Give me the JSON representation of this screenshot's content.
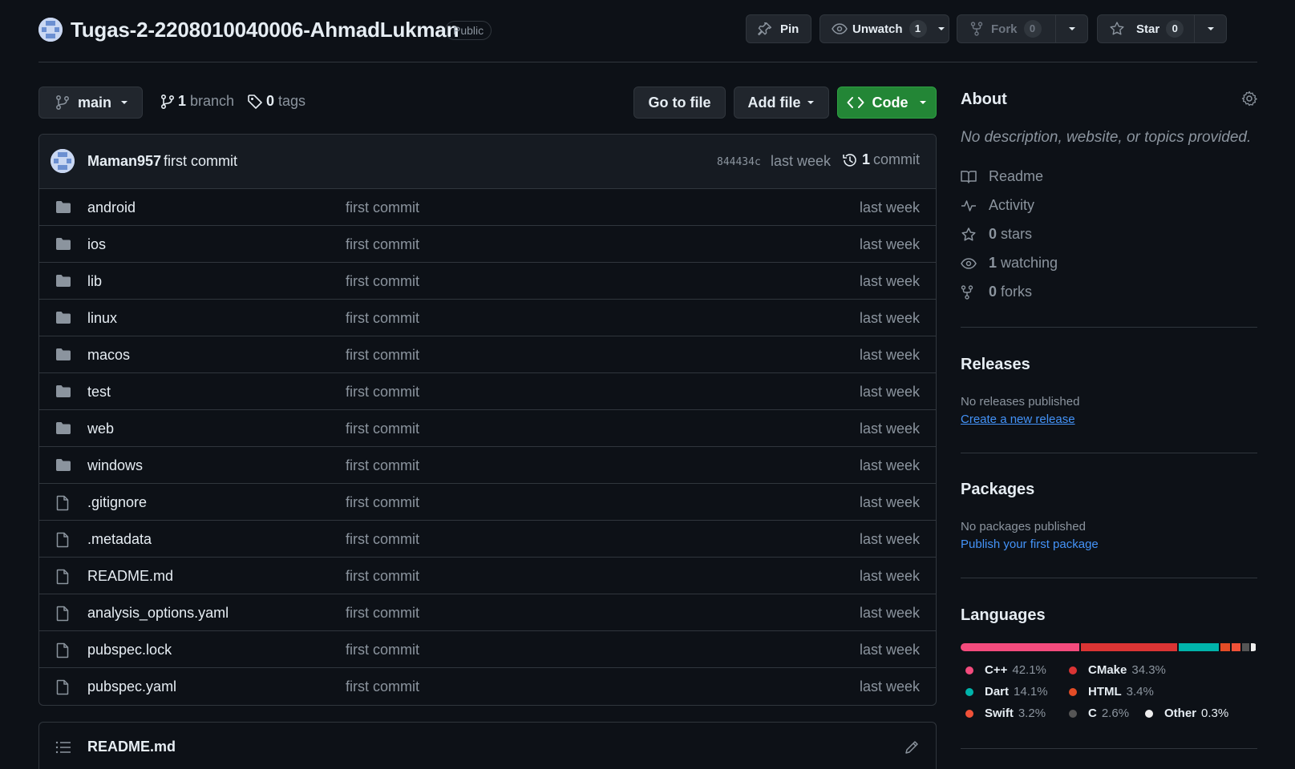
{
  "repo": {
    "name": "Tugas-2-2208010040006-AhmadLukman",
    "visibility": "Public"
  },
  "actions": {
    "pin_label": "Pin",
    "watch_label": "Unwatch",
    "watch_count": "1",
    "fork_label": "Fork",
    "fork_count": "0",
    "star_label": "Star",
    "star_count": "0"
  },
  "toolbar": {
    "branch": "main",
    "branches_count": "1",
    "branches_label": "branch",
    "tags_count": "0",
    "tags_label": "tags",
    "go_to_file": "Go to file",
    "add_file": "Add file",
    "code": "Code"
  },
  "latest_commit": {
    "author": "Maman957",
    "message": "first commit",
    "sha": "844434c",
    "when": "last week",
    "count": "1",
    "count_label": "commit"
  },
  "files": [
    {
      "name": "android",
      "type": "dir",
      "message": "first commit",
      "when": "last week"
    },
    {
      "name": "ios",
      "type": "dir",
      "message": "first commit",
      "when": "last week"
    },
    {
      "name": "lib",
      "type": "dir",
      "message": "first commit",
      "when": "last week"
    },
    {
      "name": "linux",
      "type": "dir",
      "message": "first commit",
      "when": "last week"
    },
    {
      "name": "macos",
      "type": "dir",
      "message": "first commit",
      "when": "last week"
    },
    {
      "name": "test",
      "type": "dir",
      "message": "first commit",
      "when": "last week"
    },
    {
      "name": "web",
      "type": "dir",
      "message": "first commit",
      "when": "last week"
    },
    {
      "name": "windows",
      "type": "dir",
      "message": "first commit",
      "when": "last week"
    },
    {
      "name": ".gitignore",
      "type": "file",
      "message": "first commit",
      "when": "last week"
    },
    {
      "name": ".metadata",
      "type": "file",
      "message": "first commit",
      "when": "last week"
    },
    {
      "name": "README.md",
      "type": "file",
      "message": "first commit",
      "when": "last week"
    },
    {
      "name": "analysis_options.yaml",
      "type": "file",
      "message": "first commit",
      "when": "last week"
    },
    {
      "name": "pubspec.lock",
      "type": "file",
      "message": "first commit",
      "when": "last week"
    },
    {
      "name": "pubspec.yaml",
      "type": "file",
      "message": "first commit",
      "when": "last week"
    }
  ],
  "readme": {
    "title": "README.md"
  },
  "about": {
    "heading": "About",
    "description": "No description, website, or topics provided.",
    "readme_label": "Readme",
    "activity_label": "Activity",
    "stars_count": "0",
    "stars_label": "stars",
    "watching_count": "1",
    "watching_label": "watching",
    "forks_count": "0",
    "forks_label": "forks"
  },
  "releases": {
    "heading": "Releases",
    "empty_text": "No releases published",
    "link": "Create a new release"
  },
  "packages": {
    "heading": "Packages",
    "empty_text": "No packages published",
    "link": "Publish your first package"
  },
  "languages": {
    "heading": "Languages",
    "items": [
      {
        "name": "C++",
        "percent": "42.1%",
        "value": 42.1,
        "color": "#f34b7d"
      },
      {
        "name": "CMake",
        "percent": "34.3%",
        "value": 34.3,
        "color": "#da3434"
      },
      {
        "name": "Dart",
        "percent": "14.1%",
        "value": 14.1,
        "color": "#00b4ab"
      },
      {
        "name": "HTML",
        "percent": "3.4%",
        "value": 3.4,
        "color": "#e34c26"
      },
      {
        "name": "Swift",
        "percent": "3.2%",
        "value": 3.2,
        "color": "#f05138"
      },
      {
        "name": "C",
        "percent": "2.6%",
        "value": 2.6,
        "color": "#555555"
      },
      {
        "name": "Other",
        "percent": "0.3%",
        "value": 0.3,
        "color": "#ededed"
      }
    ]
  },
  "colors": {
    "background": "#0d1117",
    "border": "#30363d",
    "muted": "#8b949e",
    "link": "#4493f8",
    "code_button": "#238636"
  }
}
